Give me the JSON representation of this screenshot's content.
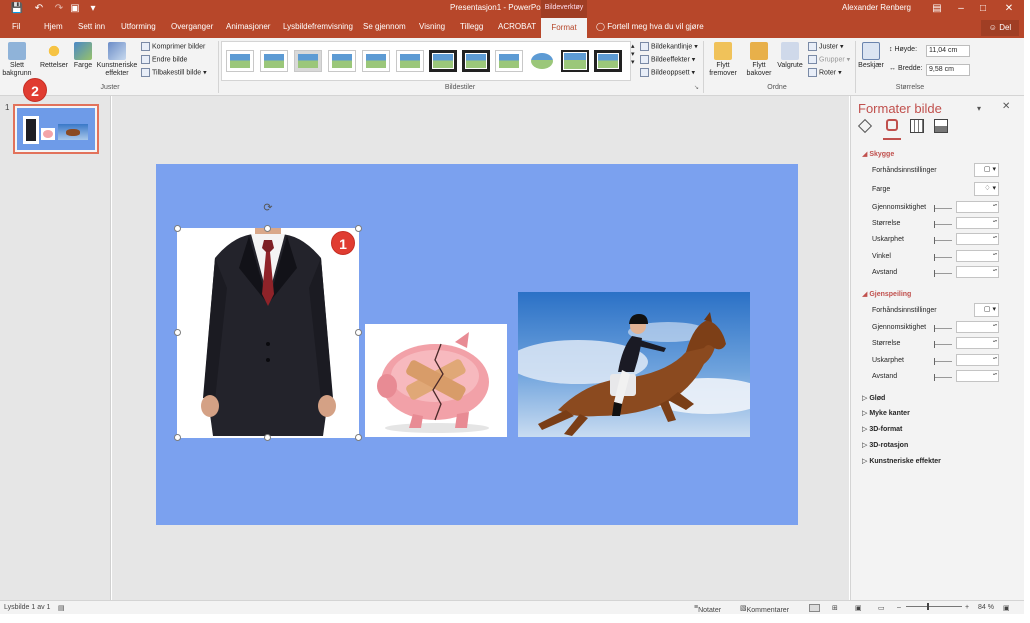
{
  "window": {
    "title": "Presentasjon1 - PowerPoint",
    "context_tab_group": "Bildeverktøy",
    "user": "Alexander Renberg",
    "share_label": "Del"
  },
  "tabs": [
    "Fil",
    "Hjem",
    "Sett inn",
    "Utforming",
    "Overganger",
    "Animasjoner",
    "Lysbildefremvisning",
    "Se gjennom",
    "Visning",
    "Tillegg",
    "ACROBAT"
  ],
  "active_tab": "Format",
  "tell_me": "Fortell meg hva du vil gjøre",
  "ribbon": {
    "remove_background": "Slett bakgrunn",
    "corrections": "Rettelser",
    "color": "Farge",
    "artistic_effects": "Kunstneriske effekter",
    "compress": "Komprimer bilder",
    "change_picture": "Endre bilde",
    "reset_picture": "Tilbakestill bilde",
    "group_adjust": "Juster",
    "group_styles": "Bildestiler",
    "picture_border": "Bildekantlinje",
    "picture_effects": "Bildeeffekter",
    "picture_layout": "Bildeoppsett",
    "bring_forward": "Flytt fremover",
    "send_backward": "Flytt bakover",
    "selection_pane": "Valgrute",
    "align": "Juster",
    "group": "Grupper",
    "rotate": "Roter",
    "group_arrange": "Ordne",
    "crop": "Beskjær",
    "height_label": "Høyde:",
    "height_value": "11,04 cm",
    "width_label": "Bredde:",
    "width_value": "9,58 cm",
    "group_size": "Størrelse"
  },
  "thumbnail": {
    "number": "1"
  },
  "markers": {
    "one": "1",
    "two": "2"
  },
  "format_pane": {
    "title": "Formater bilde",
    "shadow": {
      "header": "Skygge",
      "presets": "Forhåndsinnstillinger",
      "color": "Farge",
      "transparency": "Gjennomsiktighet",
      "size": "Størrelse",
      "blur": "Uskarphet",
      "angle": "Vinkel",
      "distance": "Avstand"
    },
    "reflection": {
      "header": "Gjenspeiling",
      "presets": "Forhåndsinnstillinger",
      "transparency": "Gjennomsiktighet",
      "size": "Størrelse",
      "blur": "Uskarphet",
      "distance": "Avstand"
    },
    "collapsed": [
      "Glød",
      "Myke kanter",
      "3D-format",
      "3D-rotasjon",
      "Kunstneriske effekter"
    ]
  },
  "statusbar": {
    "slide_info": "Lysbilde 1 av 1",
    "notes": "Notater",
    "comments": "Kommentarer",
    "zoom": "84 %",
    "zoom_level": 0.84
  },
  "colors": {
    "accent": "#b7472a",
    "slide_bg": "#7ba1ef",
    "pane_accent": "#c0504d"
  }
}
